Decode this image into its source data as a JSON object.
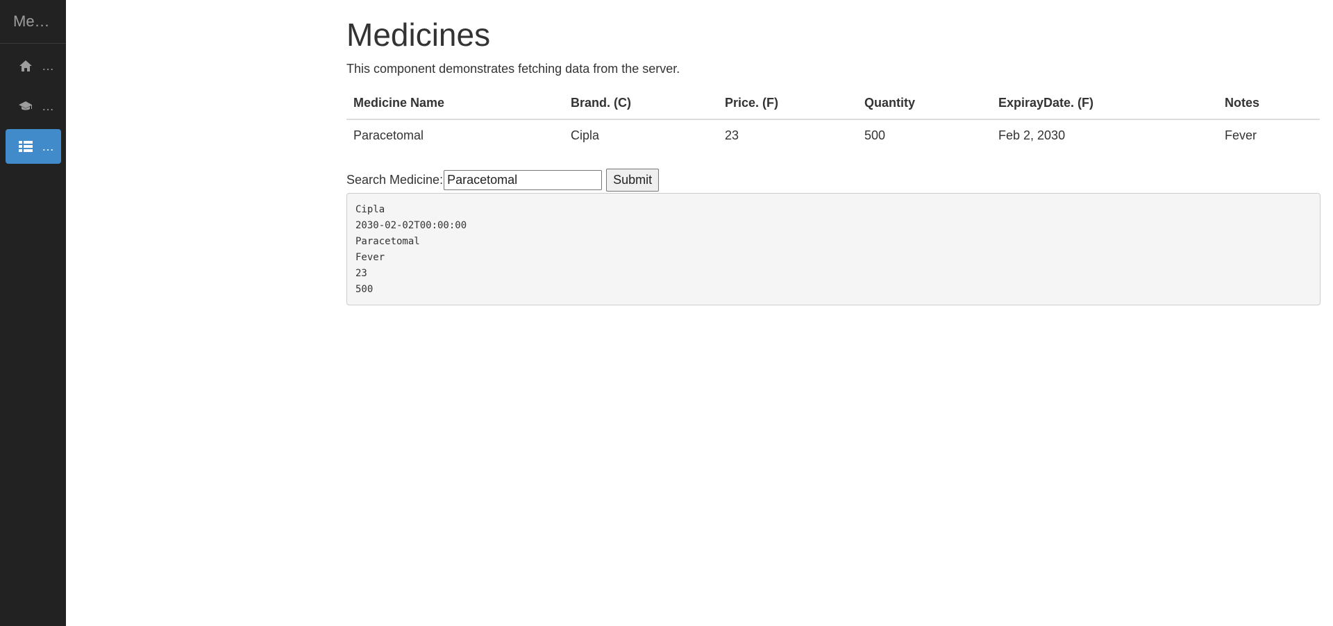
{
  "sidebar": {
    "brand": "Me…",
    "items": [
      {
        "icon": "home-icon",
        "label": "…",
        "active": false
      },
      {
        "icon": "graduation-cap-icon",
        "label": "…",
        "active": false
      },
      {
        "icon": "list-icon",
        "label": "…",
        "active": true
      }
    ]
  },
  "page": {
    "title": "Medicines",
    "subtitle": "This component demonstrates fetching data from the server."
  },
  "table": {
    "headers": [
      "Medicine Name",
      "Brand. (C)",
      "Price. (F)",
      "Quantity",
      "ExpirayDate. (F)",
      "Notes"
    ],
    "rows": [
      [
        "Paracetomal",
        "Cipla",
        "23",
        "500",
        "Feb 2, 2030",
        "Fever"
      ]
    ]
  },
  "search": {
    "label": "Search Medicine:",
    "value": "Paracetomal",
    "submit_label": "Submit"
  },
  "result": {
    "lines": [
      "Cipla",
      "2030-02-02T00:00:00",
      "Paracetomal",
      "Fever",
      "23",
      "500"
    ]
  },
  "colors": {
    "sidebar_bg": "#222222",
    "active_accent": "#428bca"
  }
}
